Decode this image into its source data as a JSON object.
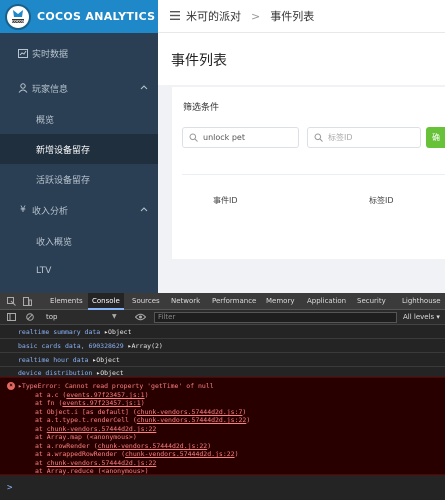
{
  "brand": {
    "name": "COCOS ANALYTICS",
    "logo_text": "COCOS"
  },
  "header": {
    "app_name": "米可的派对",
    "separator": ">",
    "current_page": "事件列表"
  },
  "page": {
    "title": "事件列表"
  },
  "sidebar": {
    "items": [
      {
        "label": "实时数据",
        "icon": "realtime-icon",
        "type": "item"
      },
      {
        "label": "玩家信息",
        "icon": "user-icon",
        "type": "group",
        "expanded": true
      },
      {
        "label": "概览",
        "type": "sub"
      },
      {
        "label": "新增设备留存",
        "type": "sub",
        "active": true
      },
      {
        "label": "活跃设备留存",
        "type": "sub"
      },
      {
        "label": "收入分析",
        "icon": "yen-icon",
        "type": "group",
        "expanded": true
      },
      {
        "label": "收入概览",
        "type": "sub"
      },
      {
        "label": "LTV",
        "type": "sub"
      }
    ]
  },
  "filter": {
    "title": "筛选条件",
    "search_value": "unlock pet",
    "tag_placeholder": "标签ID",
    "confirm_label": "确"
  },
  "table": {
    "columns": [
      "事件ID",
      "标签ID"
    ]
  },
  "devtools": {
    "tabs": [
      "Elements",
      "Console",
      "Sources",
      "Network",
      "Performance",
      "Memory",
      "Application",
      "Security",
      "Lighthouse"
    ],
    "active_tab": "Console",
    "context": "top",
    "filter_placeholder": "Filter",
    "levels": "All levels",
    "logs": [
      {
        "message": "realtime summary data",
        "value": "Object"
      },
      {
        "message": "basic cards data, 690328629",
        "value": "Array(2)"
      },
      {
        "message": "realtime hour data",
        "value": "Object"
      },
      {
        "message": "device distribution",
        "value": "Object"
      }
    ],
    "error": {
      "message": "TypeError: Cannot read property 'getTime' of null",
      "frames": [
        {
          "prefix": "at a.c (",
          "link": "events.97f23457.js:1",
          "suffix": ")"
        },
        {
          "prefix": "at fn (",
          "link": "events.97f23457.js:1",
          "suffix": ")"
        },
        {
          "prefix": "at Object.i [as default] (",
          "link": "chunk-vendors.57444d2d.js:7",
          "suffix": ")"
        },
        {
          "prefix": "at a.t.type.t.renderCell (",
          "link": "chunk-vendors.57444d2d.js:22",
          "suffix": ")"
        },
        {
          "prefix": "at ",
          "link": "chunk-vendors.57444d2d.js:22",
          "suffix": ""
        },
        {
          "prefix": "at Array.map (<anonymous>)",
          "link": "",
          "suffix": ""
        },
        {
          "prefix": "at a.rowRender (",
          "link": "chunk-vendors.57444d2d.js:22",
          "suffix": ")"
        },
        {
          "prefix": "at a.wrappedRowRender (",
          "link": "chunk-vendors.57444d2d.js:22",
          "suffix": ")"
        },
        {
          "prefix": "at ",
          "link": "chunk-vendors.57444d2d.js:22",
          "suffix": ""
        },
        {
          "prefix": "at Array.reduce (<anonymous>)",
          "link": "",
          "suffix": ""
        }
      ]
    },
    "prompt": ">"
  },
  "colors": {
    "sidebar_bg": "#2a3f54",
    "brand_blue": "#1e88c8",
    "confirm_green": "#67c23a",
    "error_bg": "#290000",
    "error_text": "#ff8080"
  }
}
